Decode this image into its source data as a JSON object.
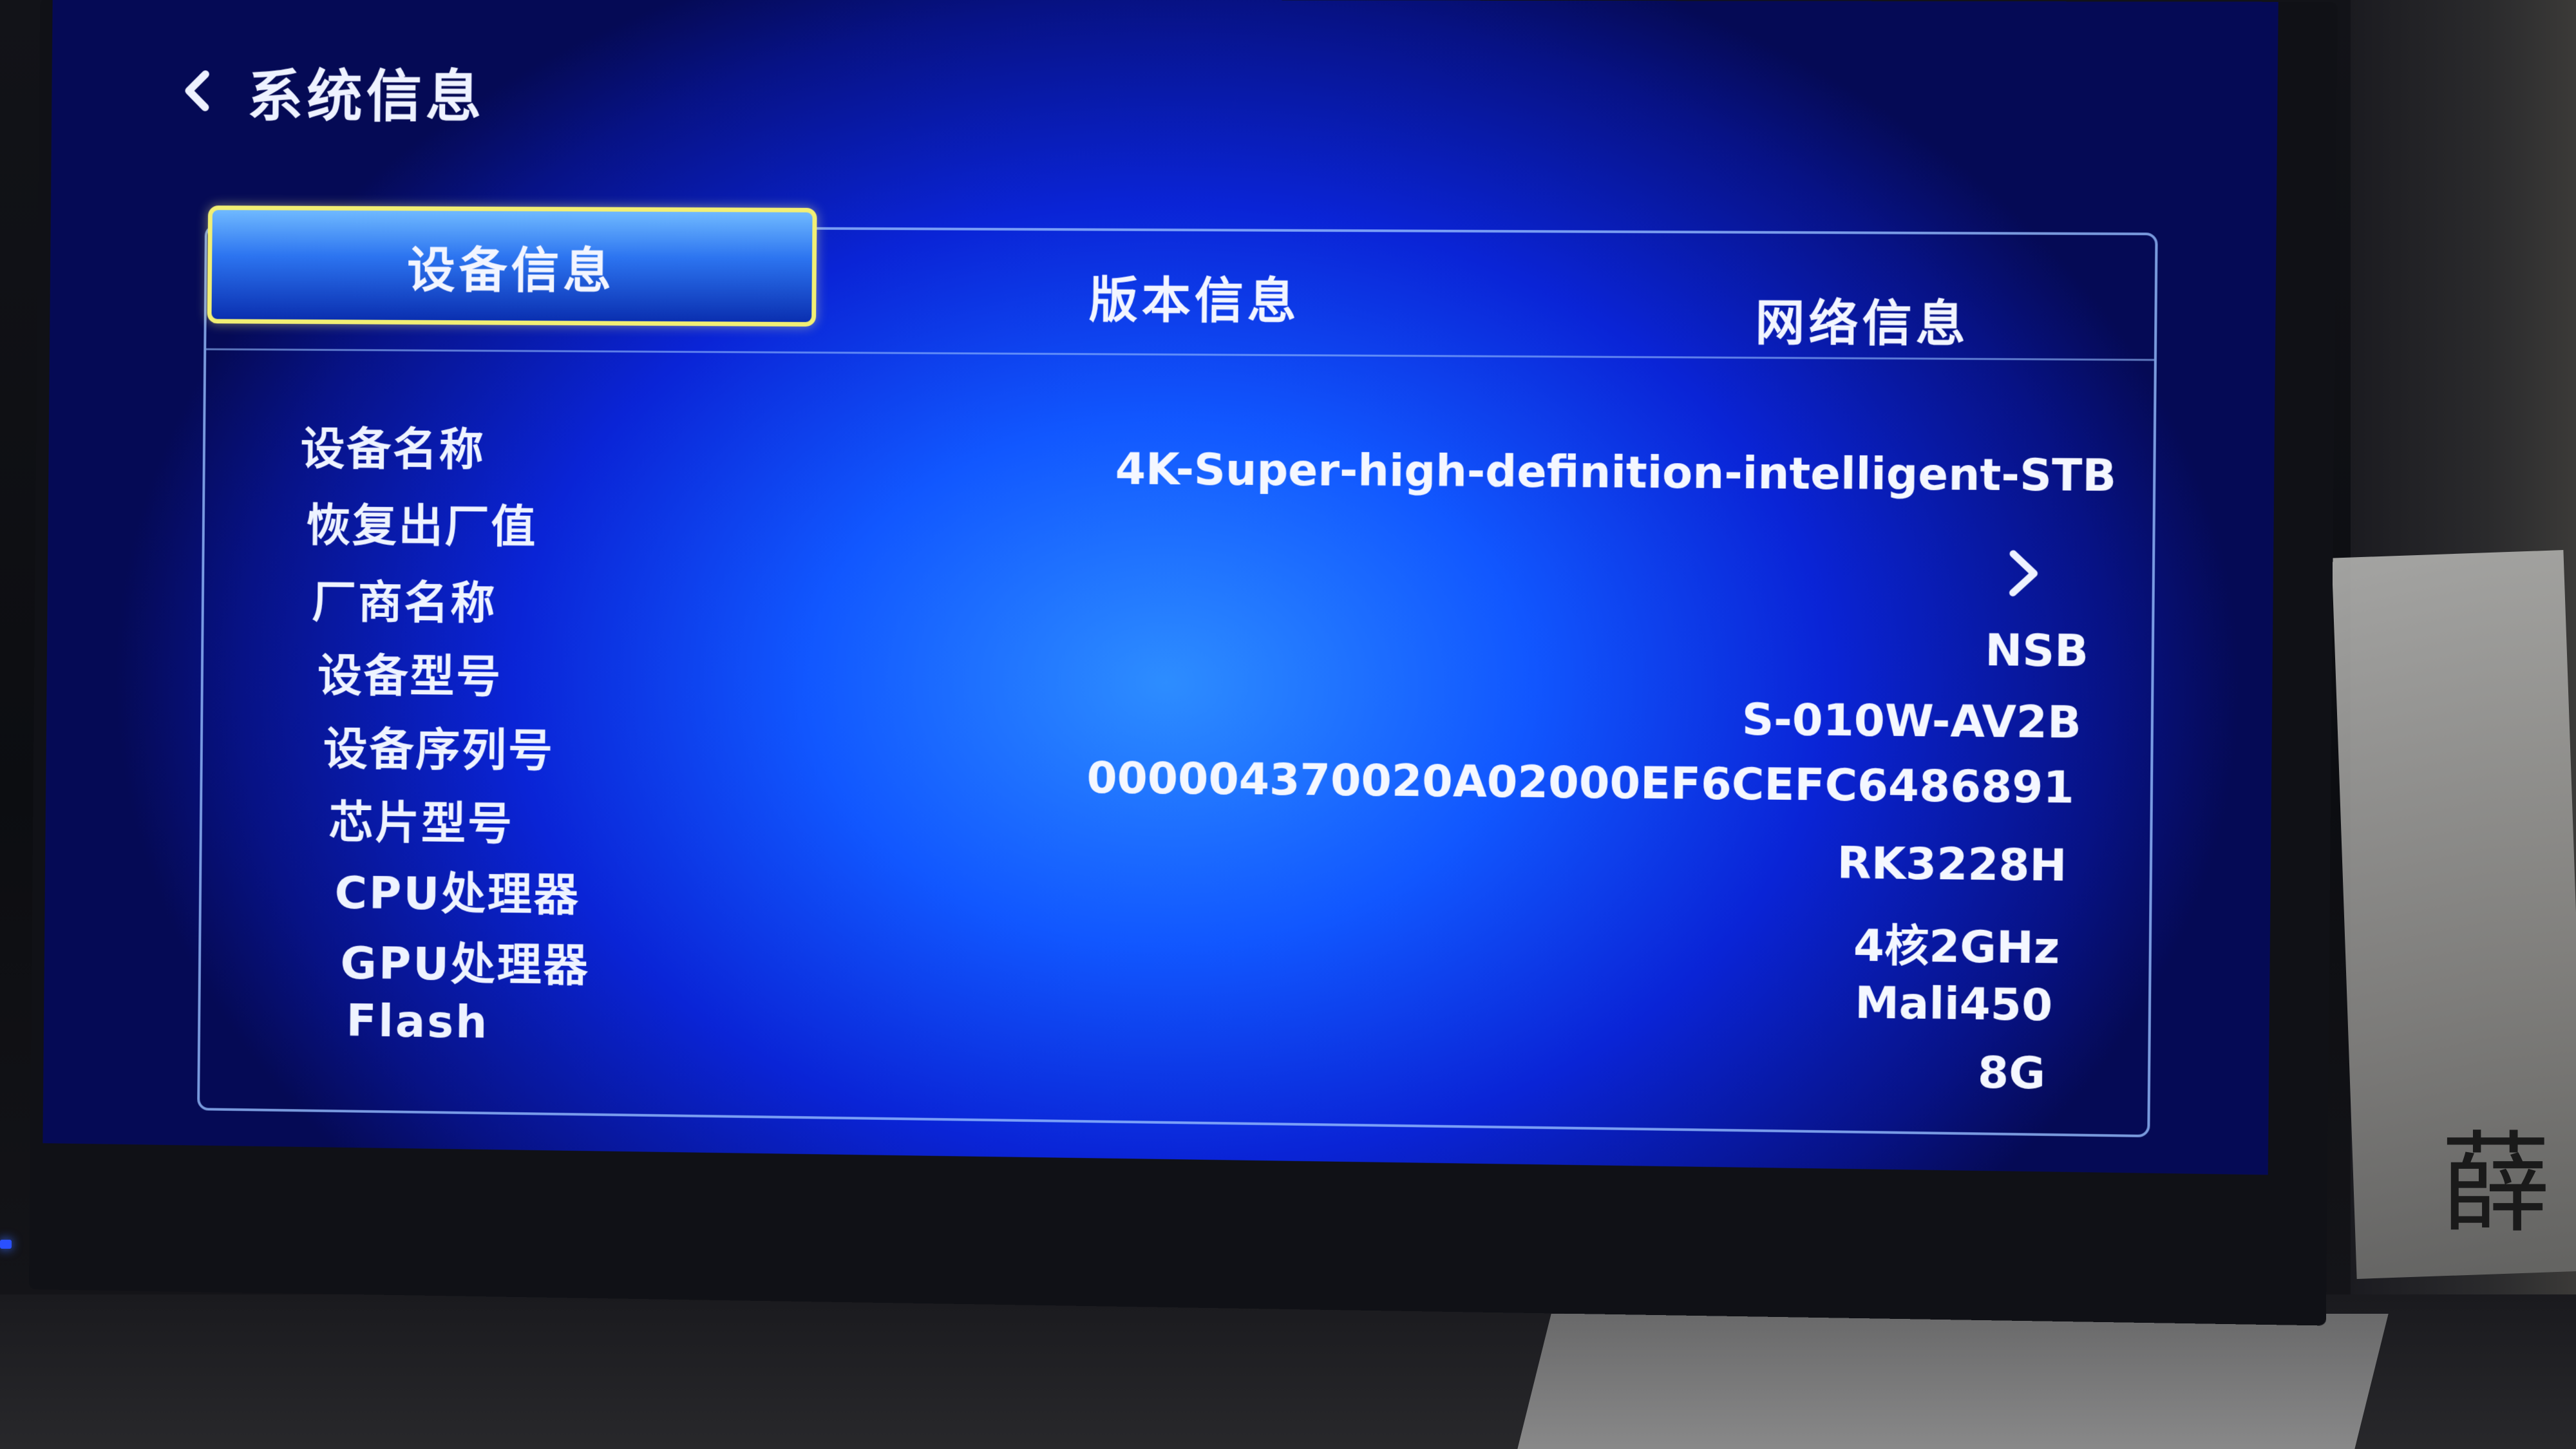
{
  "header": {
    "title": "系统信息",
    "back_icon": "chevron-left-icon"
  },
  "tabs": [
    {
      "label": "设备信息",
      "active": true
    },
    {
      "label": "版本信息",
      "active": false
    },
    {
      "label": "网络信息",
      "active": false
    }
  ],
  "device_info": {
    "rows": [
      {
        "label": "设备名称",
        "value": "4K-Super-high-definition-intelligent-STB"
      },
      {
        "label": "恢复出厂值",
        "value": "",
        "icon": "chevron-right-icon"
      },
      {
        "label": "厂商名称",
        "value": "NSB"
      },
      {
        "label": "设备型号",
        "value": "S-010W-AV2B"
      },
      {
        "label": "设备序列号",
        "value": "000004370020A02000EF6CEFC6486891"
      },
      {
        "label": "芯片型号",
        "value": "RK3228H"
      },
      {
        "label": "CPU处理器",
        "value": "4核2GHz"
      },
      {
        "label": "GPU处理器",
        "value": "Mali450"
      },
      {
        "label": "Flash",
        "value": "8G"
      }
    ]
  },
  "background_sign_glyph": "薛",
  "colors": {
    "screen_blue": "#1157ff",
    "active_tab_border": "#f2ef74",
    "panel_border": "#96beff",
    "text": "#eef3ff"
  }
}
